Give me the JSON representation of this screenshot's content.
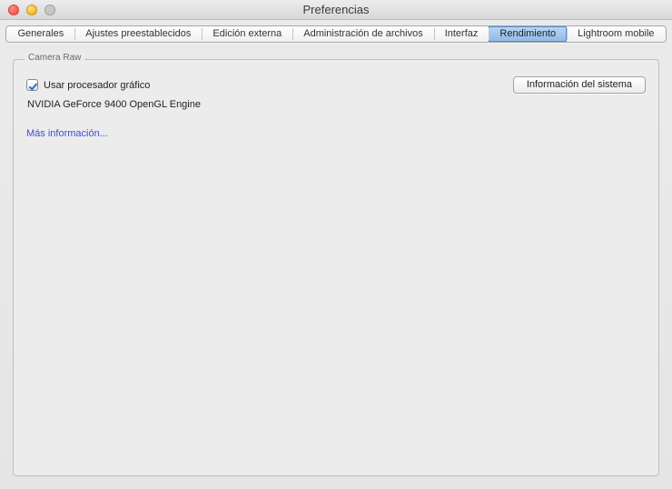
{
  "window": {
    "title": "Preferencias"
  },
  "tabs": [
    {
      "label": "Generales",
      "selected": false
    },
    {
      "label": "Ajustes preestablecidos",
      "selected": false
    },
    {
      "label": "Edición externa",
      "selected": false
    },
    {
      "label": "Administración de archivos",
      "selected": false
    },
    {
      "label": "Interfaz",
      "selected": false
    },
    {
      "label": "Rendimiento",
      "selected": true
    },
    {
      "label": "Lightroom mobile",
      "selected": false
    }
  ],
  "group": {
    "legend": "Camera Raw",
    "use_gpu_label": "Usar procesador gráfico",
    "use_gpu_checked": true,
    "gpu_name": "NVIDIA GeForce 9400 OpenGL Engine",
    "more_info": "Más información...",
    "system_info_button": "Información del sistema"
  }
}
